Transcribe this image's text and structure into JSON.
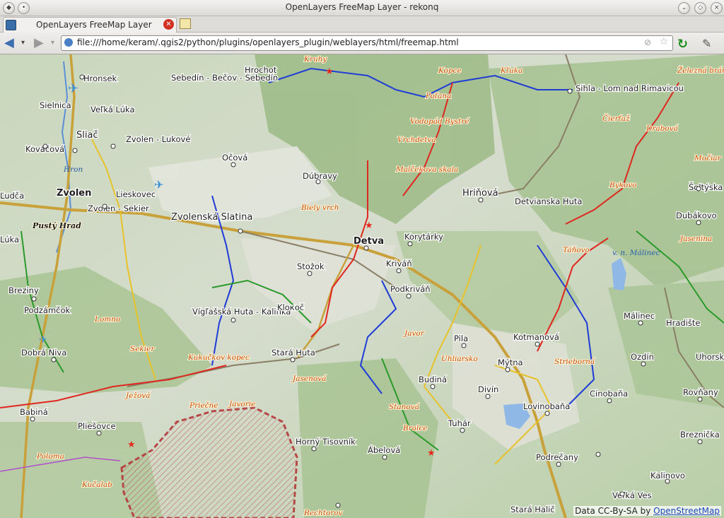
{
  "window": {
    "title": "OpenLayers FreeMap Layer - rekonq"
  },
  "tabs": [
    {
      "label": "OpenLayers FreeMap Layer"
    }
  ],
  "navbar": {
    "url": "file:///home/keram/.qgis2/python/plugins/openlayers_plugin/weblayers/html/freemap.html"
  },
  "map": {
    "attribution": "Data CC-By-SA by",
    "attribution_link": "OpenStreetMap",
    "towns": [
      "Hronsek",
      "Sielnica",
      "Veľká Lúka",
      "Sliač",
      "Zvolen - Lukové",
      "Kováčová",
      "Zvolen",
      "Lieskovec",
      "Zvolen - Sekier",
      "Zvolenská Slatina",
      "Ľudča",
      "Lúka",
      "Sebedín - Bečov - Sebedín",
      "Hrochot",
      "Očová",
      "Dúbravy",
      "Detva",
      "Korytárky",
      "Kriváň",
      "Stožok",
      "Podkriváň",
      "Hriňová",
      "Detvianska Huta",
      "Sihla - Lom nad Rimavicou",
      "Šoltýska",
      "Dubákovo",
      "Breziny",
      "Podzámčok",
      "Dobrá Niva",
      "Vígľašská Huta - Kalinka",
      "Kloкоč",
      "Stará Huta",
      "Pila",
      "Kotmanová",
      "Mýtna",
      "Budiná",
      "Divín",
      "Lovinobaňa",
      "Tuhár",
      "Málinec",
      "Hradište",
      "Ozdín",
      "Uhorské",
      "Cinobaňa",
      "Rovňany",
      "Babiná",
      "Pliešovce",
      "Horný Tisovník",
      "Ábelová",
      "Podrečany",
      "Breznička",
      "Kalinovo",
      "Veľká Ves",
      "Stará Halič"
    ],
    "hills": [
      "Kruhy",
      "Kopce",
      "Kľuka",
      "Železná brána",
      "Poľana",
      "Vodopád Bystré",
      "Vrchdetva",
      "Malčekova skala",
      "Biely vrch",
      "Čierťaž",
      "Drabová",
      "Močiar",
      "Bykovo",
      "Táňovo",
      "Jasenina",
      "Lomno",
      "Sekier",
      "Kukučkov kopec",
      "Javor",
      "Uhliarsko",
      "Strieborná",
      "Ježová",
      "Jasenová",
      "Stanová",
      "Bralce",
      "Priečne",
      "Javorie",
      "Poloma",
      "Kučalab",
      "Rechtorov",
      "Pustý Hrad"
    ],
    "water_labels": [
      "Hron",
      "v. n. Málinec"
    ]
  }
}
